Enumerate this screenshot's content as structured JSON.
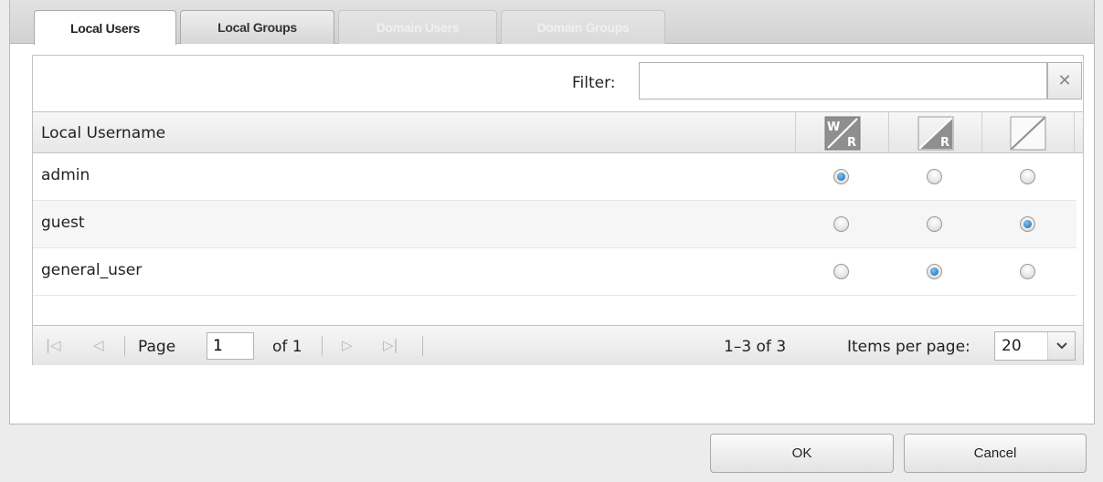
{
  "tabs": [
    {
      "label": "Local Users",
      "state": "active"
    },
    {
      "label": "Local Groups",
      "state": "normal"
    },
    {
      "label": "Domain Users",
      "state": "disabled"
    },
    {
      "label": "Domain Groups",
      "state": "disabled"
    }
  ],
  "filter": {
    "label": "Filter:",
    "value": "",
    "clear_icon": "close-icon"
  },
  "grid": {
    "column_title": "Local Username",
    "permission_columns": [
      {
        "icon": "write-read-icon",
        "letters": [
          "W",
          "R"
        ],
        "meaning": "read-write"
      },
      {
        "icon": "read-only-icon",
        "letters": [
          "R"
        ],
        "meaning": "read-only"
      },
      {
        "icon": "no-access-icon",
        "letters": [],
        "meaning": "no-access"
      }
    ],
    "rows": [
      {
        "username": "admin",
        "selected": 0
      },
      {
        "username": "guest",
        "selected": 2
      },
      {
        "username": "general_user",
        "selected": 1
      }
    ]
  },
  "pager": {
    "page_label": "Page",
    "page_value": "1",
    "of_label": "of 1",
    "range": "1–3 of 3",
    "items_per_page_label": "Items per page:",
    "items_per_page_value": "20"
  },
  "buttons": {
    "ok": "OK",
    "cancel": "Cancel"
  },
  "colors": {
    "accent_radio": "#1a64a8",
    "header_bg": "#e7e7e7",
    "window_bg": "#ececec"
  }
}
